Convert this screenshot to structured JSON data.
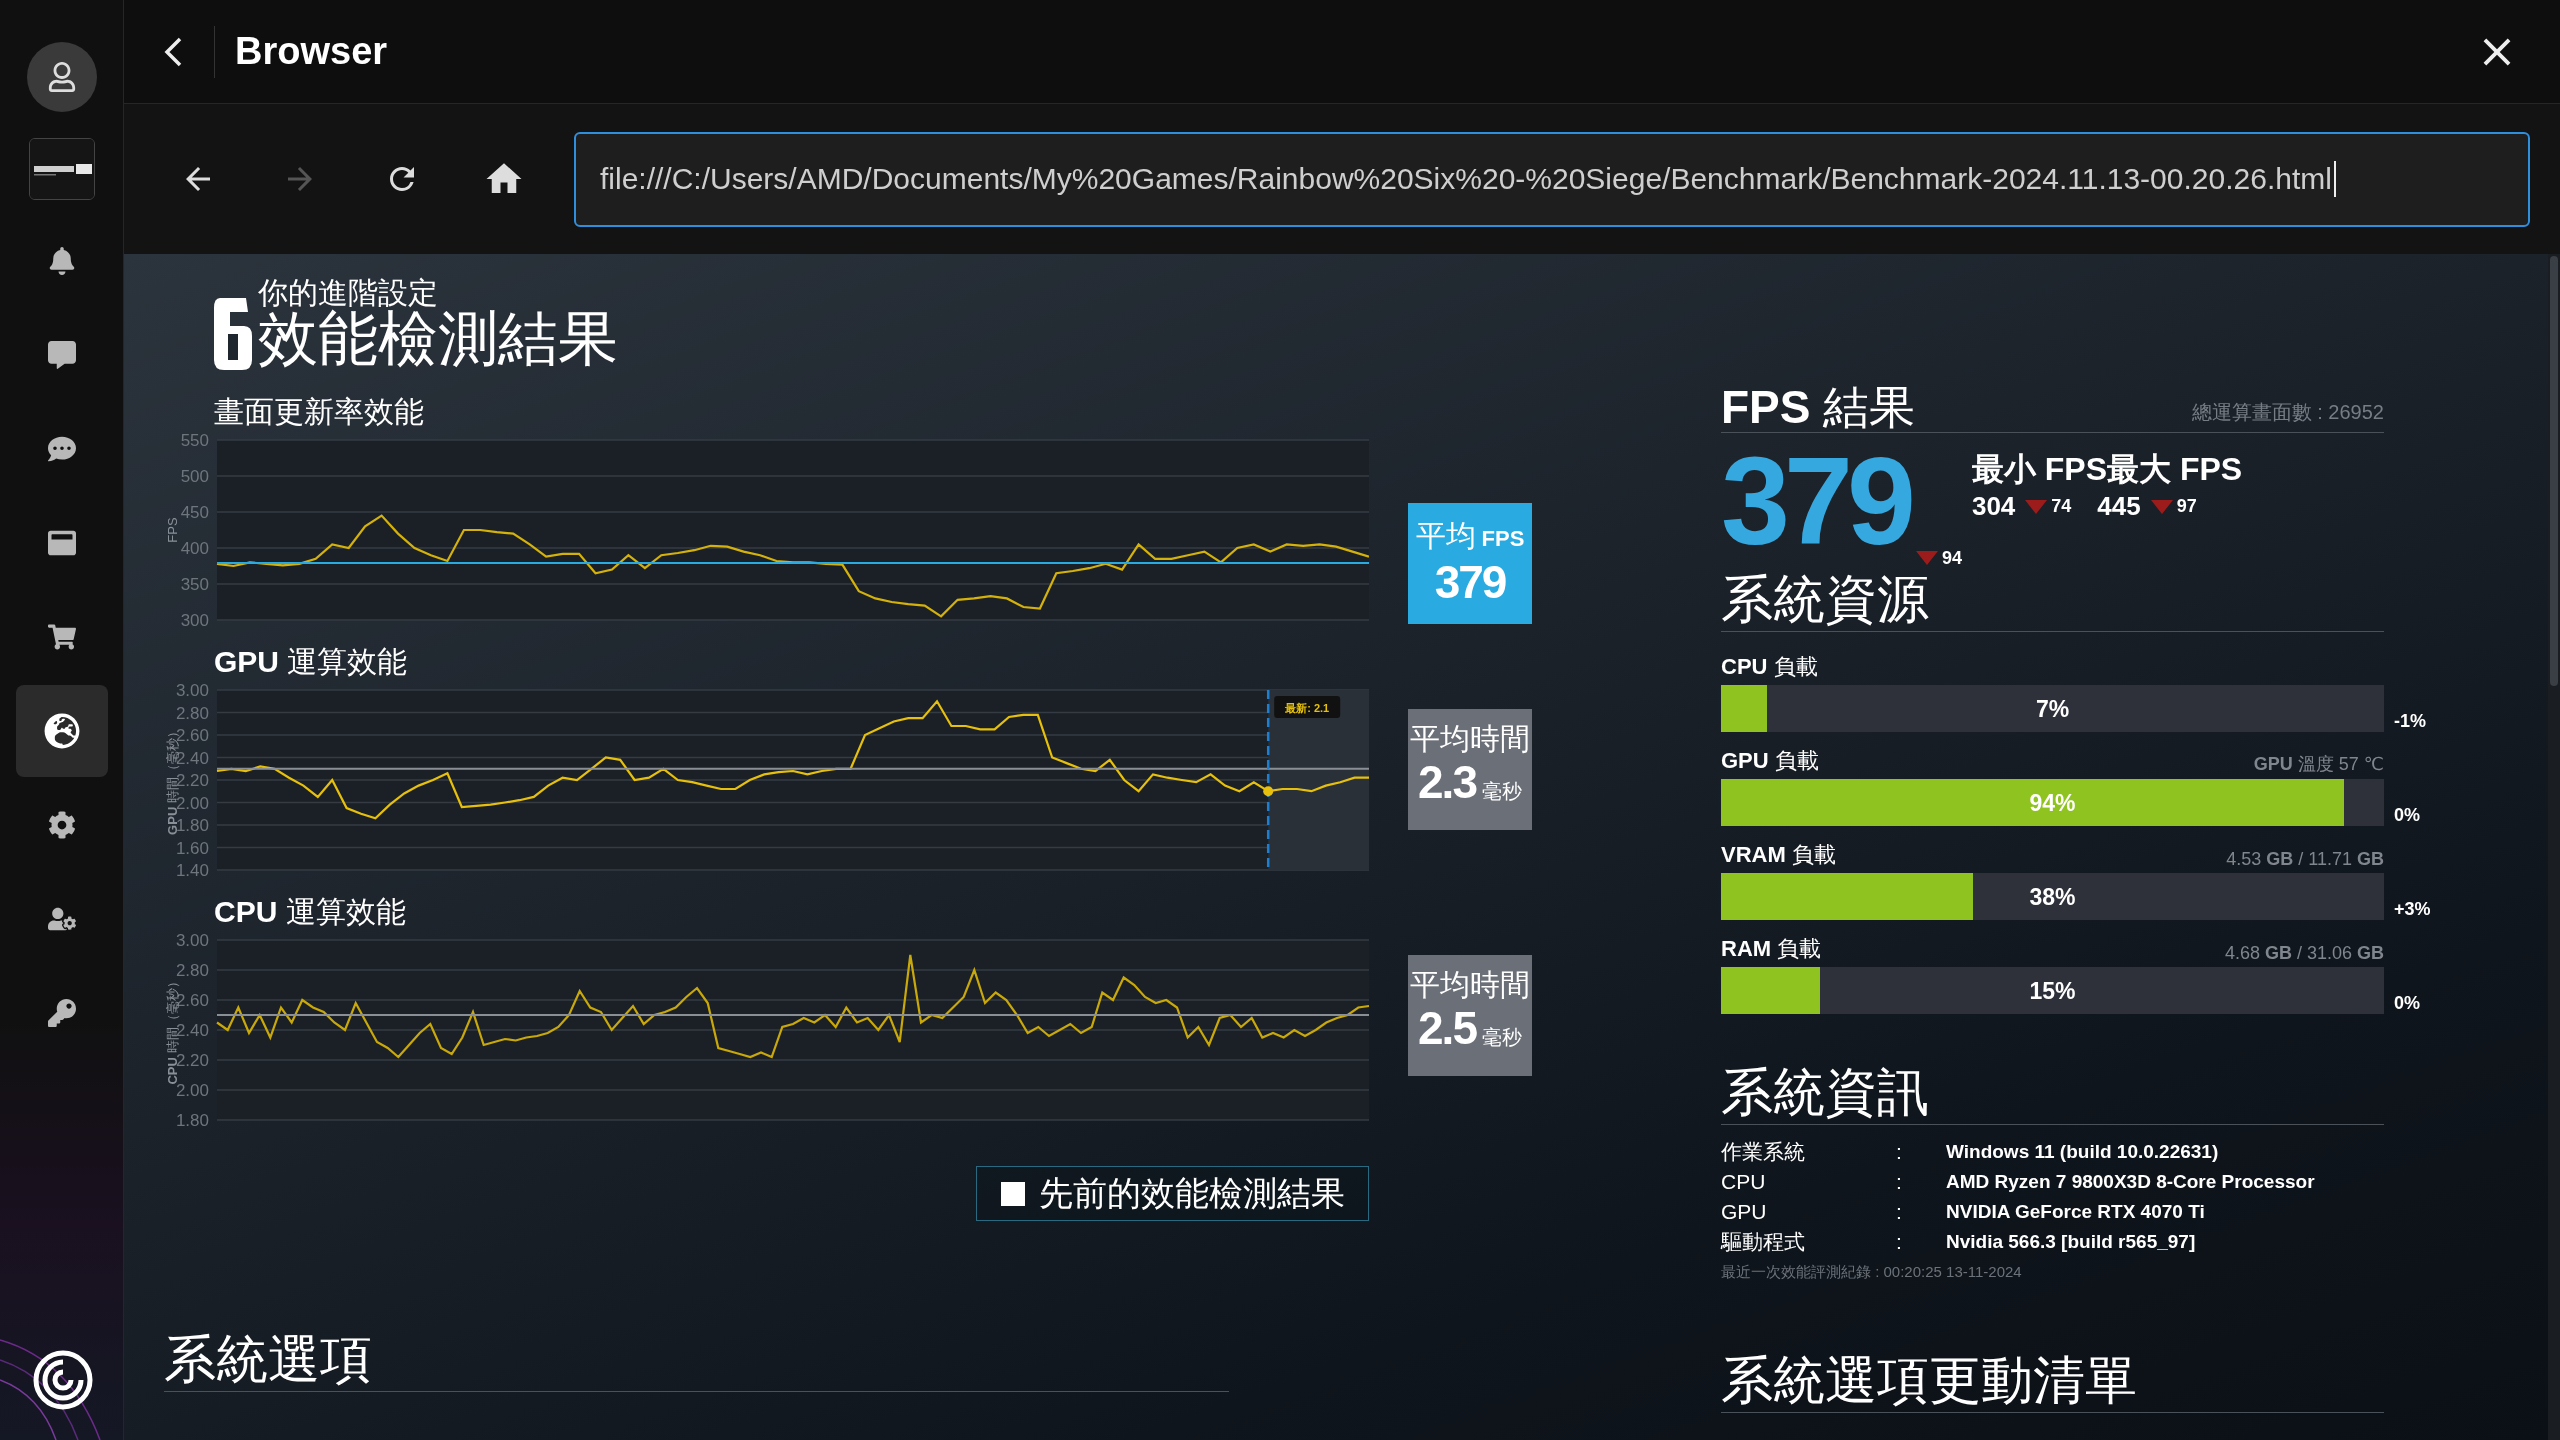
{
  "window": {
    "title": "Browser"
  },
  "nav": [
    {
      "disabled": false
    },
    {
      "disabled": true
    },
    {
      "disabled": false
    },
    {
      "disabled": false
    }
  ],
  "address": {
    "value": "file:///C:/Users/AMD/Documents/My%20Games/Rainbow%20Six%20-%20Siege/Benchmark/Benchmark-2024.11.13-00.20.26.html"
  },
  "sidebar": {
    "items": [
      {
        "selected": false
      },
      {
        "selected": false
      },
      {
        "selected": false
      },
      {
        "selected": false
      },
      {
        "selected": false
      },
      {
        "selected": true
      },
      {
        "selected": false
      },
      {
        "selected": false
      },
      {
        "selected": false
      }
    ]
  },
  "heading": {
    "overline": "你的進階設定",
    "title": "效能檢測結果"
  },
  "charts": [
    {
      "avg": {
        "label": "平均",
        "label_unit": "FPS",
        "value": "379",
        "color": "#29abe2"
      },
      "chart_data": {
        "type": "line",
        "title": "畫面更新率效能",
        "ylabel": "FPS",
        "ylim": [
          300,
          550
        ],
        "yticks": [
          300,
          350,
          400,
          450,
          500,
          550
        ],
        "grid": true,
        "series": [
          {
            "color": "#d4b20b",
            "values": [
              378,
              375,
              380,
              378,
              376,
              378,
              385,
              405,
              400,
              430,
              445,
              420,
              400,
              390,
              382,
              425,
              425,
              422,
              420,
              405,
              388,
              392,
              392,
              365,
              370,
              390,
              372,
              390,
              393,
              397,
              403,
              402,
              395,
              390,
              382,
              380,
              380,
              378,
              377,
              340,
              330,
              325,
              322,
              320,
              305,
              328,
              330,
              333,
              330,
              318,
              316,
              365,
              368,
              372,
              378,
              370,
              405,
              385,
              385,
              390,
              395,
              380,
              400,
              405,
              395,
              405,
              403,
              405,
              402,
              395,
              388
            ]
          }
        ],
        "ref_lines": [
          {
            "axis": "y",
            "value": 379
          }
        ]
      }
    },
    {
      "avg": {
        "label": "平均時間",
        "value": "2.3",
        "value_unit": "毫秒",
        "color": "#6b6f77"
      },
      "chart_data": {
        "type": "line",
        "title": "**GPU** 運算效能",
        "ylabel": "**GPU** 時間（毫秒）",
        "ylim": [
          1.4,
          3.0
        ],
        "yticks": [
          {
            "value": 1.4,
            "label": "1.40"
          },
          {
            "value": 1.6,
            "label": "1.60"
          },
          {
            "value": 1.8,
            "label": "1.80"
          },
          {
            "value": 2.0,
            "label": "2.00"
          },
          {
            "value": 2.2,
            "label": "2.20"
          },
          {
            "value": 2.4,
            "label": "2.40"
          },
          {
            "value": 2.6,
            "label": "2.60"
          },
          {
            "value": 2.8,
            "label": "2.80"
          },
          {
            "value": 3.0,
            "label": "3.00"
          }
        ],
        "grid": true,
        "series": [
          {
            "color": "#e6c00c",
            "values": [
              2.28,
              2.3,
              2.28,
              2.32,
              2.3,
              2.22,
              2.15,
              2.05,
              2.2,
              1.95,
              1.9,
              1.86,
              1.98,
              2.08,
              2.15,
              2.2,
              2.26,
              1.96,
              1.97,
              1.98,
              2.0,
              2.02,
              2.05,
              2.15,
              2.22,
              2.2,
              2.3,
              2.4,
              2.38,
              2.2,
              2.22,
              2.3,
              2.2,
              2.18,
              2.15,
              2.12,
              2.12,
              2.2,
              2.25,
              2.27,
              2.28,
              2.25,
              2.28,
              2.3,
              2.3,
              2.6,
              2.66,
              2.72,
              2.75,
              2.75,
              2.9,
              2.68,
              2.68,
              2.65,
              2.65,
              2.76,
              2.78,
              2.78,
              2.4,
              2.35,
              2.3,
              2.28,
              2.38,
              2.2,
              2.1,
              2.25,
              2.22,
              2.2,
              2.18,
              2.25,
              2.15,
              2.1,
              2.18,
              2.1,
              2.12,
              2.12,
              2.1,
              2.15,
              2.18,
              2.22,
              2.22
            ]
          }
        ],
        "ref_lines": [
          {
            "axis": "y",
            "value": 2.3
          }
        ],
        "annotations": [
          "最新: 2.1"
        ]
      }
    },
    {
      "avg": {
        "label": "平均時間",
        "value": "2.5",
        "value_unit": "毫秒",
        "color": "#6b6f77"
      },
      "chart_data": {
        "type": "line",
        "title": "**CPU** 運算效能",
        "ylabel": "**CPU** 時間（毫秒）",
        "ylim": [
          1.8,
          3.0
        ],
        "yticks": [
          {
            "value": 1.8,
            "label": "1.80"
          },
          {
            "value": 2.0,
            "label": "2.00"
          },
          {
            "value": 2.2,
            "label": "2.20"
          },
          {
            "value": 2.4,
            "label": "2.40"
          },
          {
            "value": 2.6,
            "label": "2.60"
          },
          {
            "value": 2.8,
            "label": "2.80"
          },
          {
            "value": 3.0,
            "label": "3.00"
          }
        ],
        "grid": true,
        "series": [
          {
            "color": "#c9a80a",
            "values": [
              2.45,
              2.4,
              2.55,
              2.38,
              2.5,
              2.35,
              2.55,
              2.45,
              2.6,
              2.55,
              2.52,
              2.45,
              2.4,
              2.58,
              2.45,
              2.32,
              2.28,
              2.22,
              2.3,
              2.38,
              2.44,
              2.28,
              2.24,
              2.35,
              2.52,
              2.3,
              2.32,
              2.34,
              2.33,
              2.35,
              2.36,
              2.38,
              2.42,
              2.5,
              2.66,
              2.55,
              2.52,
              2.4,
              2.48,
              2.56,
              2.44,
              2.5,
              2.52,
              2.55,
              2.62,
              2.68,
              2.58,
              2.28,
              2.26,
              2.24,
              2.22,
              2.25,
              2.22,
              2.42,
              2.44,
              2.48,
              2.45,
              2.5,
              2.42,
              2.55,
              2.45,
              2.48,
              2.4,
              2.5,
              2.32,
              2.9,
              2.45,
              2.5,
              2.48,
              2.55,
              2.62,
              2.8,
              2.58,
              2.65,
              2.6,
              2.5,
              2.38,
              2.42,
              2.36,
              2.4,
              2.44,
              2.38,
              2.42,
              2.65,
              2.6,
              2.75,
              2.7,
              2.62,
              2.58,
              2.6,
              2.55,
              2.35,
              2.42,
              2.3,
              2.48,
              2.5,
              2.42,
              2.48,
              2.35,
              2.38,
              2.35,
              2.4,
              2.36,
              2.4,
              2.45,
              2.48,
              2.5,
              2.55,
              2.56
            ]
          }
        ],
        "ref_lines": [
          {
            "axis": "y",
            "value": 2.5
          }
        ]
      }
    }
  ],
  "legend": {
    "label": "先前的效能檢測結果",
    "checked": false
  },
  "system_options": {
    "title": "系統選項"
  },
  "fps": {
    "title": "**FPS** 結果",
    "total": "總運算畫面數 : 26952",
    "average": {
      "value": "379",
      "delta": "94"
    },
    "stats": [
      {
        "label": "最小 FPS",
        "value": "304",
        "delta": "74"
      },
      {
        "label": "最大 FPS",
        "value": "445",
        "delta": "97"
      }
    ]
  },
  "resources": {
    "title": "系統資源",
    "items": [
      {
        "label": "**CPU** 負載",
        "level": 0.07,
        "reading": "7%",
        "change": "-1%"
      },
      {
        "label": "**GPU** 負載",
        "detail": "**GPU** 溫度 57 ℃",
        "level": 0.94,
        "reading": "94%",
        "change": "0%"
      },
      {
        "label": "**VRAM** 負載",
        "detail": "4.53 **GB** / 11.71 **GB**",
        "level": 0.38,
        "reading": "38%",
        "change": "+3%"
      },
      {
        "label": "**RAM** 負載",
        "detail": "4.68 **GB** / 31.06 **GB**",
        "level": 0.15,
        "reading": "15%",
        "change": "0%"
      }
    ]
  },
  "info": {
    "title": "系統資訊",
    "rows": [
      {
        "label": "作業系統",
        "separator": ":",
        "value": "Windows 11 (build 10.0.22631)"
      },
      {
        "label": "CPU",
        "separator": ":",
        "value": "AMD Ryzen 7 9800X3D 8-Core Processor"
      },
      {
        "label": "GPU",
        "separator": ":",
        "value": "NVIDIA GeForce RTX 4070 Ti"
      },
      {
        "label": "驅動程式",
        "separator": ":",
        "value": "Nvidia 566.3 [build r565_97]"
      }
    ],
    "footnote": "最近一次效能評測紀錄 : 00:20:25 13-11-2024"
  },
  "changes": {
    "title": "系統選項更動清單"
  }
}
